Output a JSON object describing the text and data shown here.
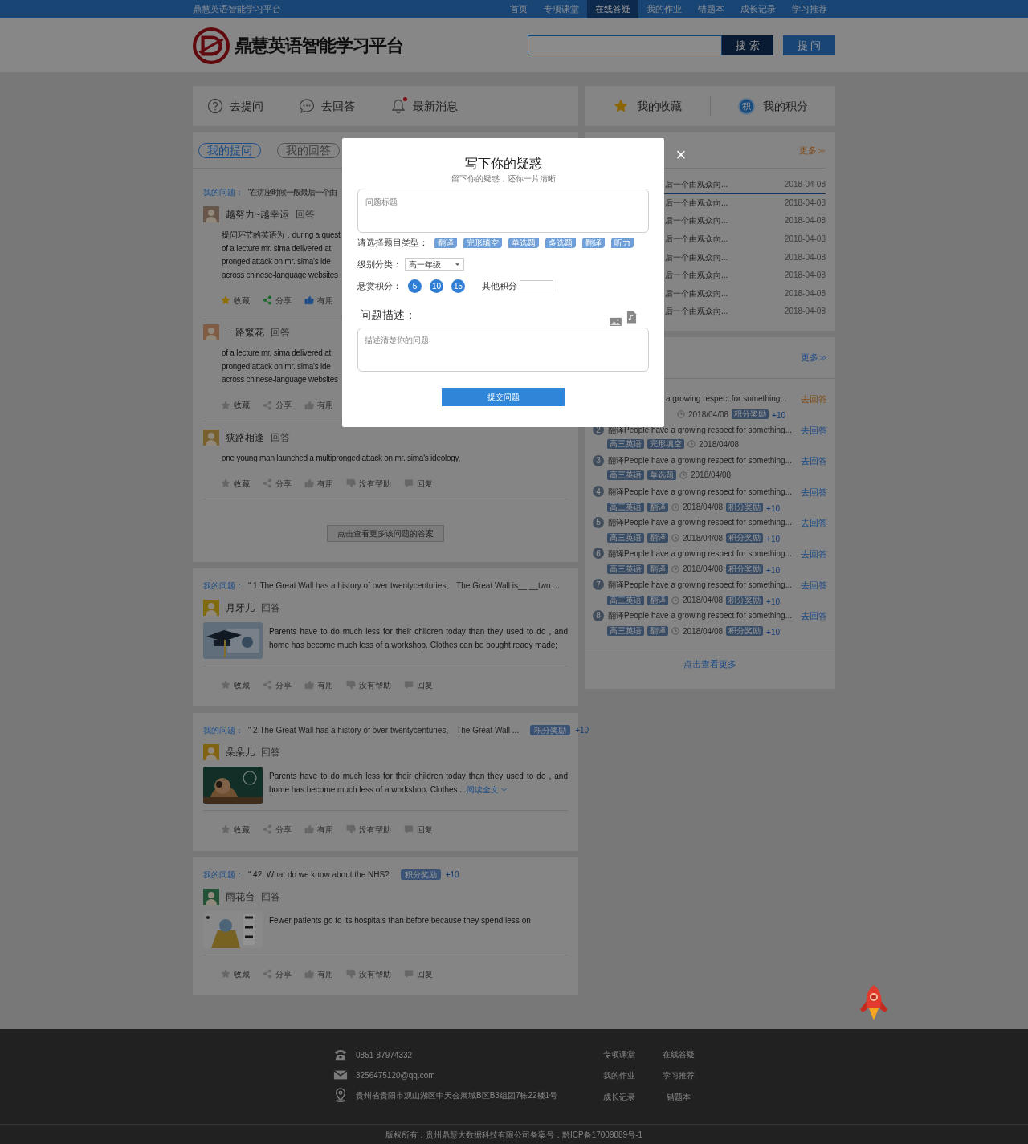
{
  "top_bar": {
    "site_name": "鼎慧英语智能学习平台",
    "nav": [
      {
        "label": "首页",
        "selected": false
      },
      {
        "label": "专项课堂",
        "selected": false
      },
      {
        "label": "在线答疑",
        "selected": true
      },
      {
        "label": "我的作业",
        "selected": false
      },
      {
        "label": "错题本",
        "selected": false
      },
      {
        "label": "成长记录",
        "selected": false
      },
      {
        "label": "学习推荐",
        "selected": false
      }
    ]
  },
  "header": {
    "logo_text": "鼎慧英语智能学习平台",
    "search_button": "搜 索",
    "ask_button": "提 问"
  },
  "quick_nav": [
    {
      "label": "去提问",
      "kind": "question",
      "dot": false
    },
    {
      "label": "去回答",
      "kind": "chat",
      "dot": false
    },
    {
      "label": "最新消息",
      "kind": "bell",
      "dot": true
    }
  ],
  "my_links": [
    {
      "label": "我的收藏",
      "kind": "star"
    },
    {
      "label": "我的积分",
      "kind": "badge",
      "badge": "积"
    }
  ],
  "question_tabs": [
    {
      "label": "我的提问",
      "selected": true
    },
    {
      "label": "我的回答",
      "selected": false
    }
  ],
  "questions": [
    {
      "prefix": "我的问题：",
      "text": "“在讲座时候一般最后一个由",
      "answers": [
        {
          "user": "越努力~越幸运",
          "verb": "回答",
          "lines": [
            "提问环节的英语为：during a quest",
            "of a lecture mr. sima delivered at",
            "pronged attack on mr. sima's ide",
            "across chinese-language websites"
          ],
          "actions": [
            {
              "kind": "star",
              "label": "收藏",
              "active": true
            },
            {
              "kind": "share",
              "label": "分享",
              "active": true
            },
            {
              "kind": "like",
              "label": "有用",
              "active": true
            }
          ]
        },
        {
          "user": "一路繁花",
          "verb": "回答",
          "lines": [
            "of a lecture mr. sima delivered at",
            "pronged attack on mr. sima's ide",
            "across chinese-language websites"
          ],
          "actions": [
            {
              "kind": "star",
              "label": "收藏",
              "active": false
            },
            {
              "kind": "share",
              "label": "分享",
              "active": false
            },
            {
              "kind": "like",
              "label": "有用",
              "active": false
            }
          ]
        },
        {
          "user": "狭路相逢",
          "verb": "回答",
          "lines": [
            "one young man launched a multipronged attack on mr. sima's ideology,"
          ],
          "actions": [
            {
              "kind": "star",
              "label": "收藏",
              "active": false
            },
            {
              "kind": "share",
              "label": "分享",
              "active": false
            },
            {
              "kind": "like",
              "label": "有用",
              "active": false
            },
            {
              "kind": "dislike",
              "label": "没有帮助",
              "active": false
            },
            {
              "kind": "reply",
              "label": "回复",
              "active": false
            }
          ]
        }
      ],
      "more_button": "点击查看更多该问题的答案"
    },
    {
      "prefix": "我的问题：",
      "text": "“ 1.The Great Wall has a history of over twentycenturies。 The Great Wall is__ __two ...",
      "answers": [
        {
          "user": "月牙儿",
          "verb": "回答",
          "image": {
            "kind": "picture"
          },
          "lines": [
            "Parents have to do much less for their children today than they used to do , and home has become much less of a workshop. Clothes can be bought ready made;"
          ],
          "actions": [
            {
              "kind": "star",
              "label": "收藏",
              "active": false
            },
            {
              "kind": "share",
              "label": "分享",
              "active": false
            },
            {
              "kind": "like",
              "label": "有用",
              "active": false
            },
            {
              "kind": "dislike",
              "label": "没有帮助",
              "active": false
            },
            {
              "kind": "reply",
              "label": "回复",
              "active": false
            }
          ]
        }
      ]
    },
    {
      "prefix": "我的问题：",
      "text": "“ 2.The Great Wall has a history of over twentycenturies。 The Great Wall ...",
      "reward": "积分奖励",
      "points": "+10",
      "answers": [
        {
          "user": "朵朵儿",
          "verb": "回答",
          "image": {
            "kind": "picture"
          },
          "lines": [
            "Parents have to do much less for their children today than they used to do , and home has become much less of a workshop. Clothes ..."
          ],
          "more_link": "阅读全文",
          "actions": [
            {
              "kind": "star",
              "label": "收藏",
              "active": false
            },
            {
              "kind": "share",
              "label": "分享",
              "active": false
            },
            {
              "kind": "like",
              "label": "有用",
              "active": false
            },
            {
              "kind": "dislike",
              "label": "没有帮助",
              "active": false
            },
            {
              "kind": "reply",
              "label": "回复",
              "active": false
            }
          ]
        }
      ]
    },
    {
      "prefix": "我的问题：",
      "text": "“ 42. What do we know about the NHS?",
      "reward": "积分奖励",
      "points": "+10",
      "answers": [
        {
          "user": "雨花台",
          "verb": "回答",
          "image": {
            "kind": "picture"
          },
          "lines": [
            "Fewer patients go to its hospitals than before because they spend less on"
          ],
          "actions": [
            {
              "kind": "star",
              "label": "收藏",
              "active": false
            },
            {
              "kind": "share",
              "label": "分享",
              "active": false
            },
            {
              "kind": "like",
              "label": "有用",
              "active": false
            },
            {
              "kind": "dislike",
              "label": "没有帮助",
              "active": false
            },
            {
              "kind": "reply",
              "label": "回复",
              "active": false
            }
          ]
        }
      ]
    }
  ],
  "latest_list": {
    "more": "更多≫",
    "items": [
      {
        "title": "后一个由观众向...",
        "date": "2018-04-08",
        "selected": true
      },
      {
        "title": "后一个由观众向...",
        "date": "2018-04-08",
        "selected": false
      },
      {
        "title": "后一个由观众向...",
        "date": "2018-04-08",
        "selected": false
      },
      {
        "title": "后一个由观众向...",
        "date": "2018-04-08",
        "selected": false
      },
      {
        "title": "后一个由观众向...",
        "date": "2018-04-08",
        "selected": false
      },
      {
        "title": "后一个由观众向...",
        "date": "2018-04-08",
        "selected": false
      },
      {
        "title": "后一个由观众向...",
        "date": "2018-04-08",
        "selected": false
      },
      {
        "title": "后一个由观众向...",
        "date": "2018-04-08",
        "selected": false
      }
    ]
  },
  "answer_list": {
    "more": "更多≫",
    "items": [
      {
        "title": "a growing respect for something...",
        "date": "2018/04/08",
        "reward": "积分奖励",
        "points": "+10",
        "action": "去回答",
        "highlight": true
      },
      {
        "num": "2",
        "title": "翻译People have a growing respect for something...",
        "tags": [
          "高三英语",
          "完形填空"
        ],
        "date": "2018/04/08",
        "action": "去回答",
        "highlight": false
      },
      {
        "num": "3",
        "title": "翻译People have a growing respect for something...",
        "tags": [
          "高三英语",
          "单选题"
        ],
        "date": "2018/04/08",
        "action": "去回答",
        "highlight": false
      },
      {
        "num": "4",
        "title": "翻译People have a growing respect for something...",
        "tags": [
          "高三英语",
          "翻译"
        ],
        "date": "2018/04/08",
        "reward": "积分奖励",
        "points": "+10",
        "action": "去回答",
        "highlight": false
      },
      {
        "num": "5",
        "title": "翻译People have a growing respect for something...",
        "tags": [
          "高三英语",
          "翻译"
        ],
        "date": "2018/04/08",
        "reward": "积分奖励",
        "points": "+10",
        "action": "去回答",
        "highlight": false
      },
      {
        "num": "6",
        "title": "翻译People have a growing respect for something...",
        "tags": [
          "高三英语",
          "翻译"
        ],
        "date": "2018/04/08",
        "reward": "积分奖励",
        "points": "+10",
        "action": "去回答",
        "highlight": false
      },
      {
        "num": "7",
        "title": "翻译People have a growing respect for something...",
        "tags": [
          "高三英语",
          "翻译"
        ],
        "date": "2018/04/08",
        "reward": "积分奖励",
        "points": "+10",
        "action": "去回答",
        "highlight": false
      },
      {
        "num": "8",
        "title": "翻译People have a growing respect for something...",
        "tags": [
          "高三英语",
          "翻译"
        ],
        "date": "2018/04/08",
        "reward": "积分奖励",
        "points": "+10",
        "action": "去回答",
        "highlight": false
      }
    ],
    "more_link": "点击查看更多"
  },
  "modal": {
    "title": "写下你的疑惑",
    "subtitle": "留下你的疑惑，还你一片清晰",
    "close": "×",
    "title_placeholder": "问题标题",
    "type_label": "请选择题目类型：",
    "types": [
      "翻译",
      "完形填空",
      "单选题",
      "多选题",
      "翻译",
      "听力"
    ],
    "level_label": "级别分类：",
    "level_value": "高一年级",
    "reward_label": "悬赏积分：",
    "reward_options": [
      "5",
      "10",
      "15"
    ],
    "other_label": "其他积分",
    "desc_label": "问题描述：",
    "desc_placeholder": "描述清楚你的问题",
    "submit": "提交问题"
  },
  "footer": {
    "contacts": [
      {
        "kind": "phone",
        "text": "0851-87974332"
      },
      {
        "kind": "mail",
        "text": "3256475120@qq.com"
      },
      {
        "kind": "pin",
        "text": "贵州省贵阳市观山湖区中天会展城B区B3组团7栋22楼1号"
      }
    ],
    "links": [
      "专项课堂",
      "在线答疑",
      "我的作业",
      "学习推荐",
      "成长记录",
      "错题本"
    ],
    "copyright": "版权所有：贵州鼎慧大数据科技有限公司备案号：黔ICP备17009889号-1"
  }
}
